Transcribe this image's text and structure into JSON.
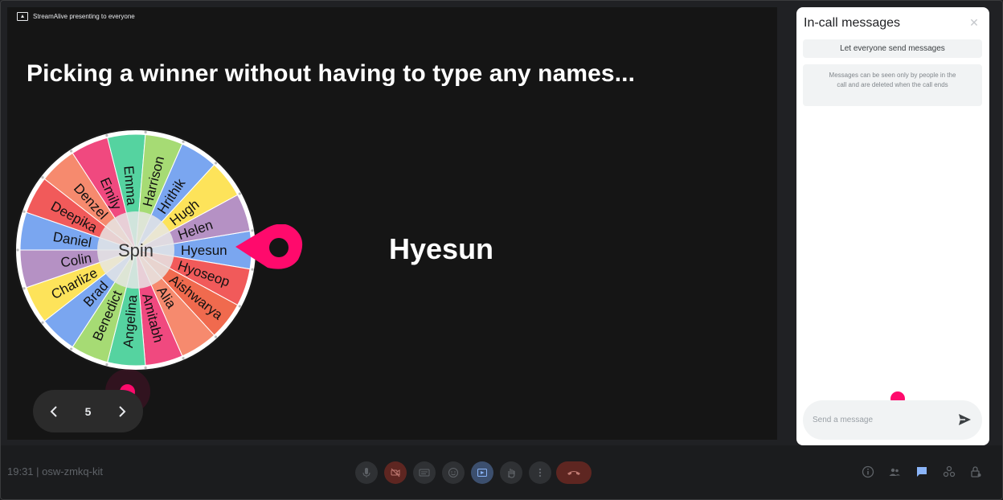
{
  "presenting": {
    "label": "StreamAlive presenting to everyone"
  },
  "slide": {
    "title": "Picking a winner without having to type any names...",
    "winner": "Hyesun",
    "spin_label": "Spin",
    "page": "5"
  },
  "wheel": {
    "names": [
      "Hyesun",
      "Hyoseop",
      "Aishwarya",
      "Alia",
      "Amitabh",
      "Angelina",
      "Benedict",
      "Brad",
      "Charlize",
      "Colin",
      "Daniel",
      "Deepika",
      "Denzel",
      "Emily",
      "Emma",
      "Harrison",
      "Hrithik",
      "Hugh",
      "Helen"
    ],
    "colors": [
      "#7aa6f0",
      "#f15a5a",
      "#f06a4e",
      "#f68a6e",
      "#f0497f",
      "#55d3a0",
      "#a6db74",
      "#7aa6f0",
      "#fde35a",
      "#b591c4",
      "#7aa6f0",
      "#f15a5a",
      "#f68a6e",
      "#f0497f",
      "#55d3a0",
      "#a6db74",
      "#7aa6f0",
      "#fde35a",
      "#b591c4"
    ],
    "pointer_color": "#ff0a6c"
  },
  "chat": {
    "title": "In-call messages",
    "toggle_label": "Let everyone send messages",
    "info": "Messages can be seen only by people in the call and are deleted when the call ends",
    "input_placeholder": "Send a message"
  },
  "bottom_bar": {
    "meeting_info": "19:31 | osw-zmkq-kit",
    "controls": [
      "mic-icon",
      "camera-off-icon",
      "captions-icon",
      "emoji-icon",
      "present-icon",
      "raise-hand-icon",
      "more-options-icon"
    ],
    "right_controls": [
      "info-icon",
      "people-icon",
      "chat-icon",
      "activities-icon",
      "lock-icon"
    ]
  },
  "colors": {
    "accent": "#ff0a6c",
    "end_call": "#5e2621",
    "camera_off": "#5e2621",
    "present_active": "#3c4f6e"
  }
}
